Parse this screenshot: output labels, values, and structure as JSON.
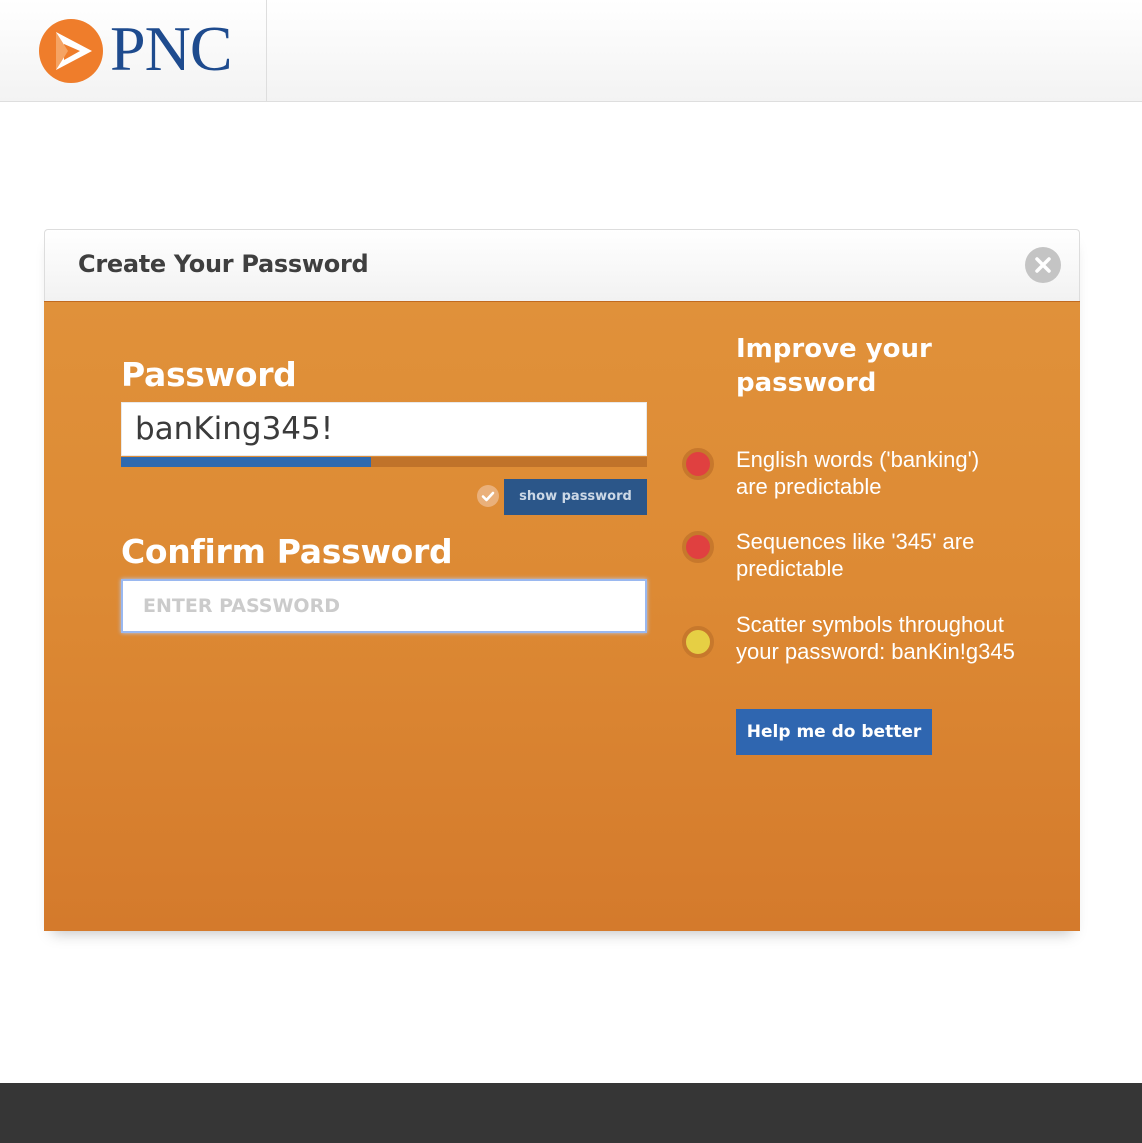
{
  "brand": {
    "name": "PNC",
    "logo_icon": "pnc-triangle-logo"
  },
  "modal": {
    "title": "Create Your Password",
    "close_icon": "close-icon"
  },
  "password": {
    "label": "Password",
    "value": "banKing345!",
    "strength": 0.475,
    "show_label": "show password"
  },
  "confirm": {
    "label": "Confirm Password",
    "placeholder": "ENTER PASSWORD"
  },
  "tips": {
    "title": "Improve your password",
    "items": [
      {
        "text": "English words ('banking') are predictable",
        "color": "#e04040"
      },
      {
        "text": "Sequences like '345' are predictable",
        "color": "#e04040"
      },
      {
        "text": "Scatter symbols throughout your password: banKin!g345",
        "color": "#e6cf44"
      }
    ],
    "help_label": "Help me do better"
  },
  "colors": {
    "brand_blue": "#1e4b8e",
    "brand_orange": "#ef7d2b",
    "modal_orange": "#dd8a34",
    "button_blue": "#2f66b0"
  }
}
